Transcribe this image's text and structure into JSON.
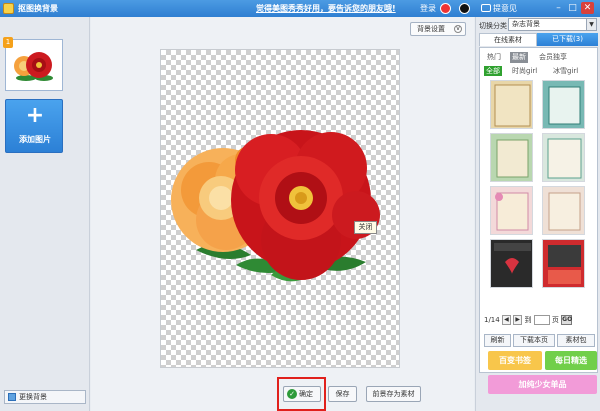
{
  "titlebar": {
    "app_title": "抠图换背景",
    "promo": "觉得美图秀秀好用，要告诉您的朋友哦!",
    "login": "登录",
    "feedback": "提意见",
    "min": "–",
    "max": "□",
    "close": "✕"
  },
  "left": {
    "badge": "1",
    "add_label": "添加图片",
    "add_plus": "+",
    "change_bg": "更换背景"
  },
  "center": {
    "bg_settings": "背景设置",
    "tooltip": "关闭",
    "ok": "确定",
    "save": "保存",
    "save_as_material": "前景存为素材"
  },
  "right": {
    "category_label": "切换分类",
    "category_value": "杂志背景",
    "tab_online": "在线素材",
    "tab_downloaded": "已下载(3)",
    "subtabs": [
      "热门",
      "最新",
      "会员独享"
    ],
    "filters": [
      "全部",
      "时尚girl",
      "冰雪girl"
    ],
    "page_info": "1/14",
    "page_to": "到",
    "page_unit": "页",
    "go": "GO",
    "refresh": "刷新",
    "download_page": "下载本页",
    "material_pack": "素材包",
    "btn_100": "百变书签",
    "btn_daily": "每日精选",
    "btn_youth": "加纯少女单品"
  },
  "colors": {
    "accent": "#2f7fd2",
    "highlight": "#e0201c",
    "flower_red": "#c8141a",
    "flower_orange": "#f39a3a",
    "leaf": "#2f8a34"
  }
}
